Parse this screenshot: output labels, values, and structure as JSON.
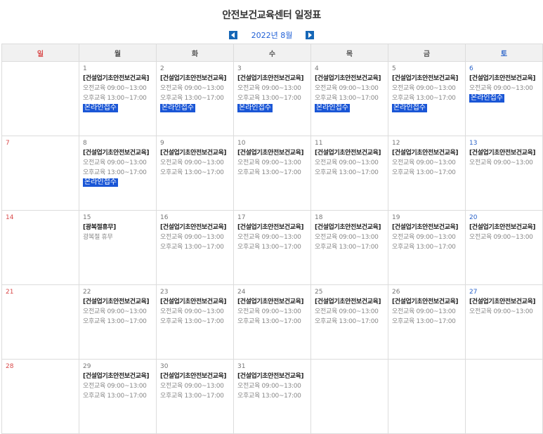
{
  "page_title": "안전보건교육센터 일정표",
  "month_label": "2022년 8월",
  "colors": {
    "nav": "#1667b7",
    "badge": "#1a56d6",
    "sunday": "#d94a4a",
    "saturday": "#2b63c9"
  },
  "weekdays": [
    "일",
    "월",
    "화",
    "수",
    "목",
    "금",
    "토"
  ],
  "weeks": [
    [
      null,
      {
        "day": "1",
        "title": "[건설업기초안전보건교육]",
        "lines": [
          "오전교육 09:00~13:00",
          "오후교육 13:00~17:00"
        ],
        "badge": "온라인접수"
      },
      {
        "day": "2",
        "title": "[건설업기초안전보건교육]",
        "lines": [
          "오전교육 09:00~13:00",
          "오후교육 13:00~17:00"
        ],
        "badge": "온라인접수"
      },
      {
        "day": "3",
        "title": "[건설업기초안전보건교육]",
        "lines": [
          "오전교육 09:00~13:00",
          "오후교육 13:00~17:00"
        ],
        "badge": "온라인접수"
      },
      {
        "day": "4",
        "title": "[건설업기초안전보건교육]",
        "lines": [
          "오전교육 09:00~13:00",
          "오후교육 13:00~17:00"
        ],
        "badge": "온라인접수"
      },
      {
        "day": "5",
        "title": "[건설업기초안전보건교육]",
        "lines": [
          "오전교육 09:00~13:00",
          "오후교육 13:00~17:00"
        ],
        "badge": "온라인접수"
      },
      {
        "day": "6",
        "title": "[건설업기초안전보건교육]",
        "lines": [
          "오전교육 09:00~13:00"
        ],
        "badge": "온라인접수"
      }
    ],
    [
      {
        "day": "7"
      },
      {
        "day": "8",
        "title": "[건설업기초안전보건교육]",
        "lines": [
          "오전교육 09:00~13:00",
          "오후교육 13:00~17:00"
        ],
        "badge": "온라인접수"
      },
      {
        "day": "9",
        "title": "[건설업기초안전보건교육]",
        "lines": [
          "오전교육 09:00~13:00",
          "오후교육 13:00~17:00"
        ]
      },
      {
        "day": "10",
        "title": "[건설업기초안전보건교육]",
        "lines": [
          "오전교육 09:00~13:00",
          "오후교육 13:00~17:00"
        ]
      },
      {
        "day": "11",
        "title": "[건설업기초안전보건교육]",
        "lines": [
          "오전교육 09:00~13:00",
          "오후교육 13:00~17:00"
        ]
      },
      {
        "day": "12",
        "title": "[건설업기초안전보건교육]",
        "lines": [
          "오전교육 09:00~13:00",
          "오후교육 13:00~17:00"
        ]
      },
      {
        "day": "13",
        "title": "[건설업기초안전보건교육]",
        "lines": [
          "오전교육 09:00~13:00"
        ]
      }
    ],
    [
      {
        "day": "14"
      },
      {
        "day": "15",
        "title": "[광복절휴무]",
        "lines": [
          "광복절 휴무"
        ]
      },
      {
        "day": "16",
        "title": "[건설업기초안전보건교육]",
        "lines": [
          "오전교육 09:00~13:00",
          "오후교육 13:00~17:00"
        ]
      },
      {
        "day": "17",
        "title": "[건설업기초안전보건교육]",
        "lines": [
          "오전교육 09:00~13:00",
          "오후교육 13:00~17:00"
        ]
      },
      {
        "day": "18",
        "title": "[건설업기초안전보건교육]",
        "lines": [
          "오전교육 09:00~13:00",
          "오후교육 13:00~17:00"
        ]
      },
      {
        "day": "19",
        "title": "[건설업기초안전보건교육]",
        "lines": [
          "오전교육 09:00~13:00",
          "오후교육 13:00~17:00"
        ]
      },
      {
        "day": "20",
        "title": "[건설업기초안전보건교육]",
        "lines": [
          "오전교육 09:00~13:00"
        ]
      }
    ],
    [
      {
        "day": "21"
      },
      {
        "day": "22",
        "title": "[건설업기초안전보건교육]",
        "lines": [
          "오전교육 09:00~13:00",
          "오후교육 13:00~17:00"
        ]
      },
      {
        "day": "23",
        "title": "[건설업기초안전보건교육]",
        "lines": [
          "오전교육 09:00~13:00",
          "오후교육 13:00~17:00"
        ]
      },
      {
        "day": "24",
        "title": "[건설업기초안전보건교육]",
        "lines": [
          "오전교육 09:00~13:00",
          "오후교육 13:00~17:00"
        ]
      },
      {
        "day": "25",
        "title": "[건설업기초안전보건교육]",
        "lines": [
          "오전교육 09:00~13:00",
          "오후교육 13:00~17:00"
        ]
      },
      {
        "day": "26",
        "title": "[건설업기초안전보건교육]",
        "lines": [
          "오전교육 09:00~13:00",
          "오후교육 13:00~17:00"
        ]
      },
      {
        "day": "27",
        "title": "[건설업기초안전보건교육]",
        "lines": [
          "오전교육 09:00~13:00"
        ]
      }
    ],
    [
      {
        "day": "28"
      },
      {
        "day": "29",
        "title": "[건설업기초안전보건교육]",
        "lines": [
          "오전교육 09:00~13:00",
          "오후교육 13:00~17:00"
        ]
      },
      {
        "day": "30",
        "title": "[건설업기초안전보건교육]",
        "lines": [
          "오전교육 09:00~13:00",
          "오후교육 13:00~17:00"
        ]
      },
      {
        "day": "31",
        "title": "[건설업기초안전보건교육]",
        "lines": [
          "오전교육 09:00~13:00",
          "오후교육 13:00~17:00"
        ]
      },
      null,
      null,
      null
    ]
  ]
}
